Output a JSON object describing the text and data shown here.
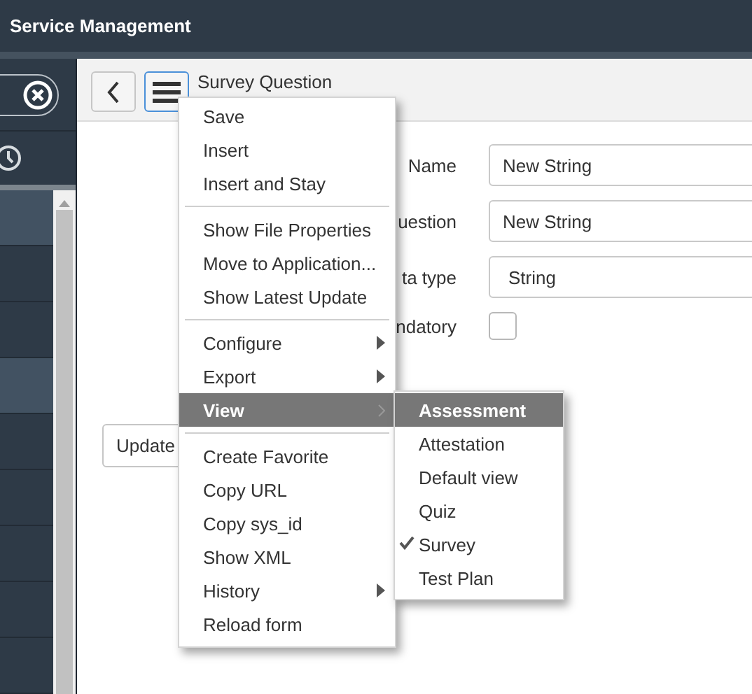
{
  "header": {
    "title": "Service Management"
  },
  "nav_rows": [
    {
      "highlighted": true
    },
    {
      "highlighted": false
    },
    {
      "highlighted": false
    },
    {
      "highlighted": true
    },
    {
      "highlighted": false
    },
    {
      "highlighted": false
    },
    {
      "highlighted": false
    },
    {
      "highlighted": false
    },
    {
      "highlighted": false
    }
  ],
  "form_header": {
    "title": "Survey Question"
  },
  "fields": [
    {
      "kind": "text",
      "label": "Name",
      "value": "New String"
    },
    {
      "kind": "text",
      "label": "uestion",
      "value": "New String"
    },
    {
      "kind": "select",
      "label": "ta type",
      "value": "String"
    },
    {
      "kind": "checkbox",
      "label": "ndatory",
      "checked": false
    }
  ],
  "update_button": "Update",
  "menu": {
    "groups": [
      [
        {
          "label": "Save",
          "submenu": false,
          "selected": false
        },
        {
          "label": "Insert",
          "submenu": false,
          "selected": false
        },
        {
          "label": "Insert and Stay",
          "submenu": false,
          "selected": false
        }
      ],
      [
        {
          "label": "Show File Properties",
          "submenu": false,
          "selected": false
        },
        {
          "label": "Move to Application...",
          "submenu": false,
          "selected": false
        },
        {
          "label": "Show Latest Update",
          "submenu": false,
          "selected": false
        }
      ],
      [
        {
          "label": "Configure",
          "submenu": true,
          "selected": false
        },
        {
          "label": "Export",
          "submenu": true,
          "selected": false
        },
        {
          "label": "View",
          "submenu": true,
          "selected": true
        }
      ],
      [
        {
          "label": "Create Favorite",
          "submenu": false,
          "selected": false
        },
        {
          "label": "Copy URL",
          "submenu": false,
          "selected": false
        },
        {
          "label": "Copy sys_id",
          "submenu": false,
          "selected": false
        },
        {
          "label": "Show XML",
          "submenu": false,
          "selected": false
        },
        {
          "label": "History",
          "submenu": true,
          "selected": false
        },
        {
          "label": "Reload form",
          "submenu": false,
          "selected": false
        }
      ]
    ]
  },
  "submenu": {
    "items": [
      {
        "label": "Assessment",
        "selected": true,
        "checked": false
      },
      {
        "label": "Attestation",
        "selected": false,
        "checked": false
      },
      {
        "label": "Default view",
        "selected": false,
        "checked": false
      },
      {
        "label": "Quiz",
        "selected": false,
        "checked": false
      },
      {
        "label": "Survey",
        "selected": false,
        "checked": true
      },
      {
        "label": "Test Plan",
        "selected": false,
        "checked": false
      }
    ]
  }
}
